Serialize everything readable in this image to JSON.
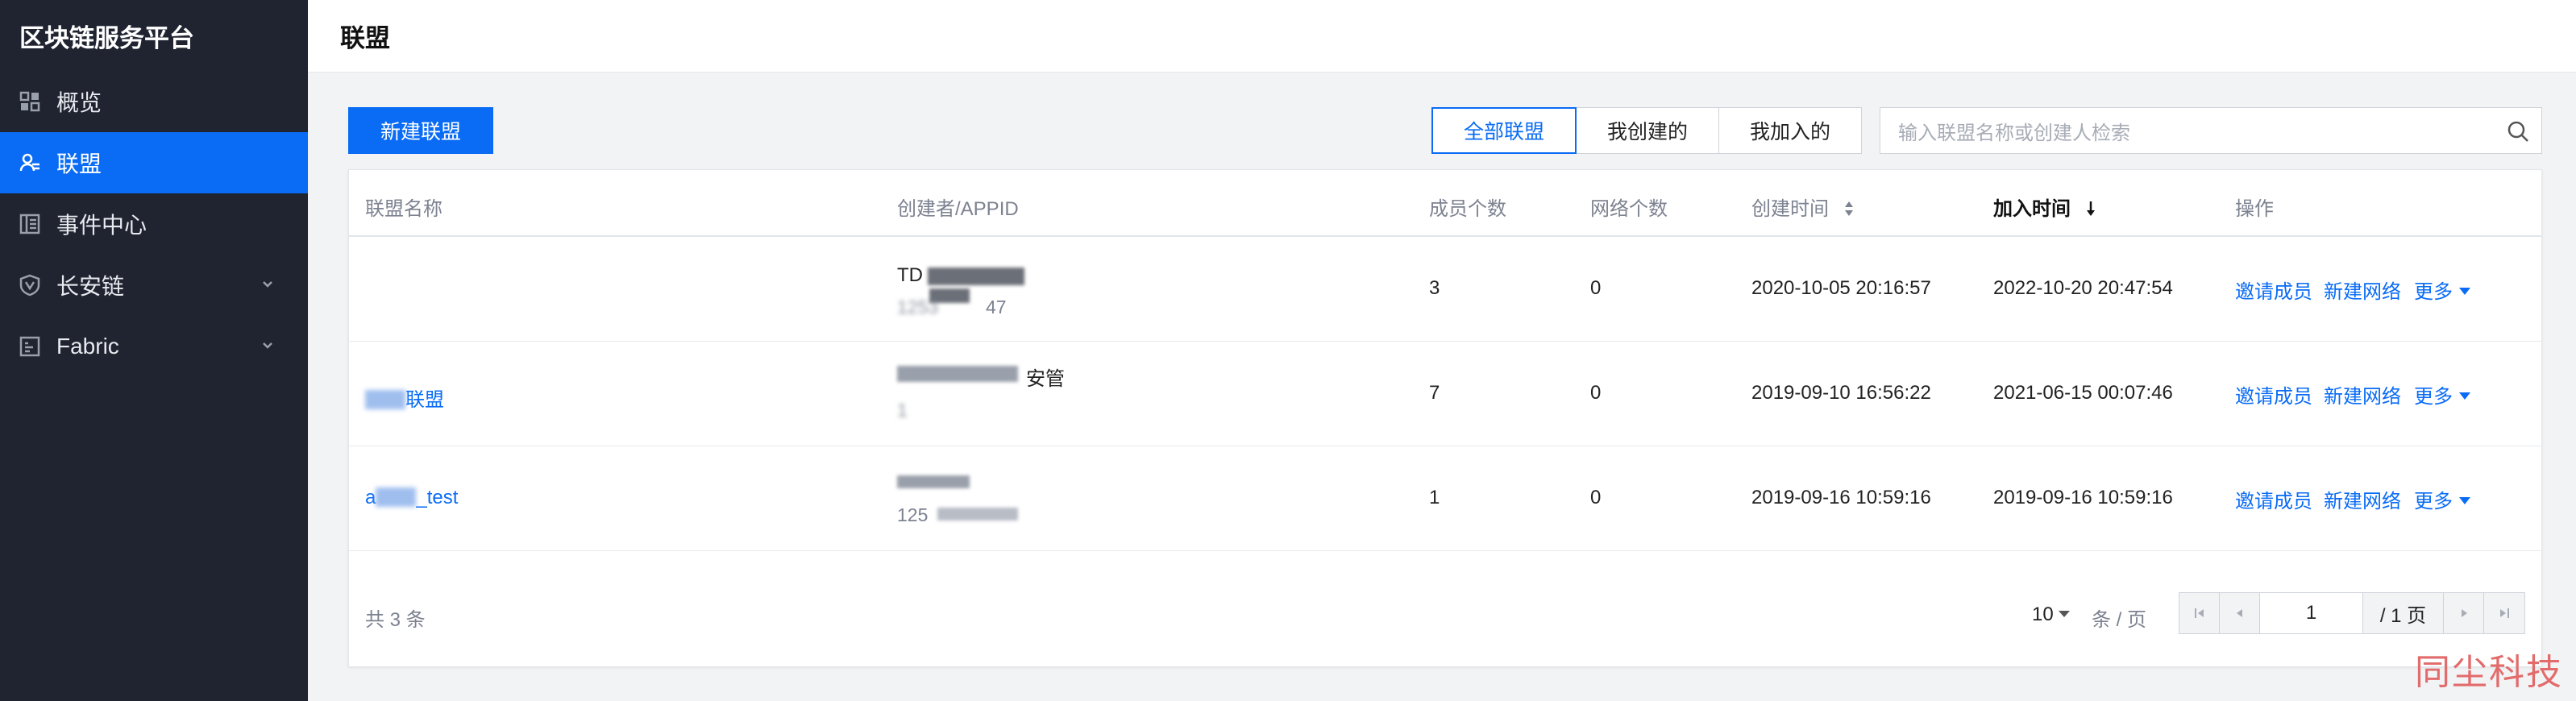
{
  "sidebar": {
    "brand": "区块链服务平台",
    "items": [
      {
        "label": "概览",
        "icon": "grid-icon",
        "active": false,
        "expandable": false
      },
      {
        "label": "联盟",
        "icon": "users-icon",
        "active": true,
        "expandable": false
      },
      {
        "label": "事件中心",
        "icon": "document-icon",
        "active": false,
        "expandable": false
      },
      {
        "label": "长安链",
        "icon": "shield-icon",
        "active": false,
        "expandable": true
      },
      {
        "label": "Fabric",
        "icon": "list-icon",
        "active": false,
        "expandable": true
      }
    ]
  },
  "header": {
    "title": "联盟"
  },
  "toolbar": {
    "new_button": "新建联盟",
    "filters": [
      "全部联盟",
      "我创建的",
      "我加入的"
    ],
    "active_filter": "全部联盟",
    "search_placeholder": "输入联盟名称或创建人检索"
  },
  "table": {
    "columns": [
      "联盟名称",
      "创建者/APPID",
      "成员个数",
      "网络个数",
      "创建时间",
      "加入时间",
      "操作"
    ],
    "sorted_column": "加入时间",
    "rows": [
      {
        "name": "",
        "creator": "TD",
        "appid": "1253",
        "appid_tail": "47",
        "members": "3",
        "networks": "0",
        "created": "2020-10-05 20:16:57",
        "joined": "2022-10-20 20:47:54"
      },
      {
        "name": "联盟",
        "creator": "",
        "creator_tail": "安管",
        "appid": "1",
        "members": "7",
        "networks": "0",
        "created": "2019-09-10 16:56:22",
        "joined": "2021-06-15 00:07:46"
      },
      {
        "name": "a",
        "name_tail": "_test",
        "creator": "",
        "appid": "125",
        "members": "1",
        "networks": "0",
        "created": "2019-09-16 10:59:16",
        "joined": "2019-09-16 10:59:16"
      }
    ],
    "actions": {
      "invite": "邀请成员",
      "new_network": "新建网络",
      "more": "更多"
    }
  },
  "pagination": {
    "total": "共 3 条",
    "page_size": "10",
    "per_page": "条 / 页",
    "current_page": "1",
    "total_pages": "/ 1 页"
  },
  "watermark": "同尘科技",
  "colors": {
    "accent": "#0a6cf5",
    "sidebar_bg": "#1f2430",
    "watermark": "#e26b6b"
  }
}
